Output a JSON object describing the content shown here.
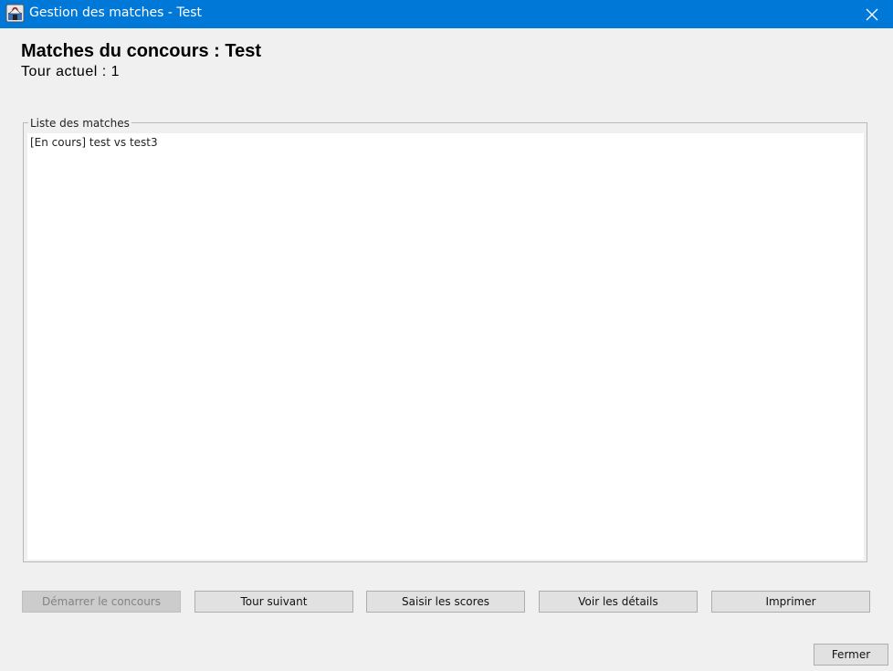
{
  "window": {
    "title": "Gestion des matches - Test",
    "title_bar_color": "#0078d7",
    "app_icon": "app-icon",
    "close_icon": "close-icon"
  },
  "header": {
    "title": "Matches du concours : Test",
    "current_round": "Tour actuel : 1"
  },
  "match_list": {
    "group_label": "Liste des matches",
    "items": [
      "[En cours] test vs test3"
    ]
  },
  "actions": {
    "start": "Démarrer le concours",
    "next_round": "Tour suivant",
    "enter_scores": "Saisir les scores",
    "view_details": "Voir les détails",
    "print": "Imprimer"
  },
  "footer": {
    "close": "Fermer"
  }
}
